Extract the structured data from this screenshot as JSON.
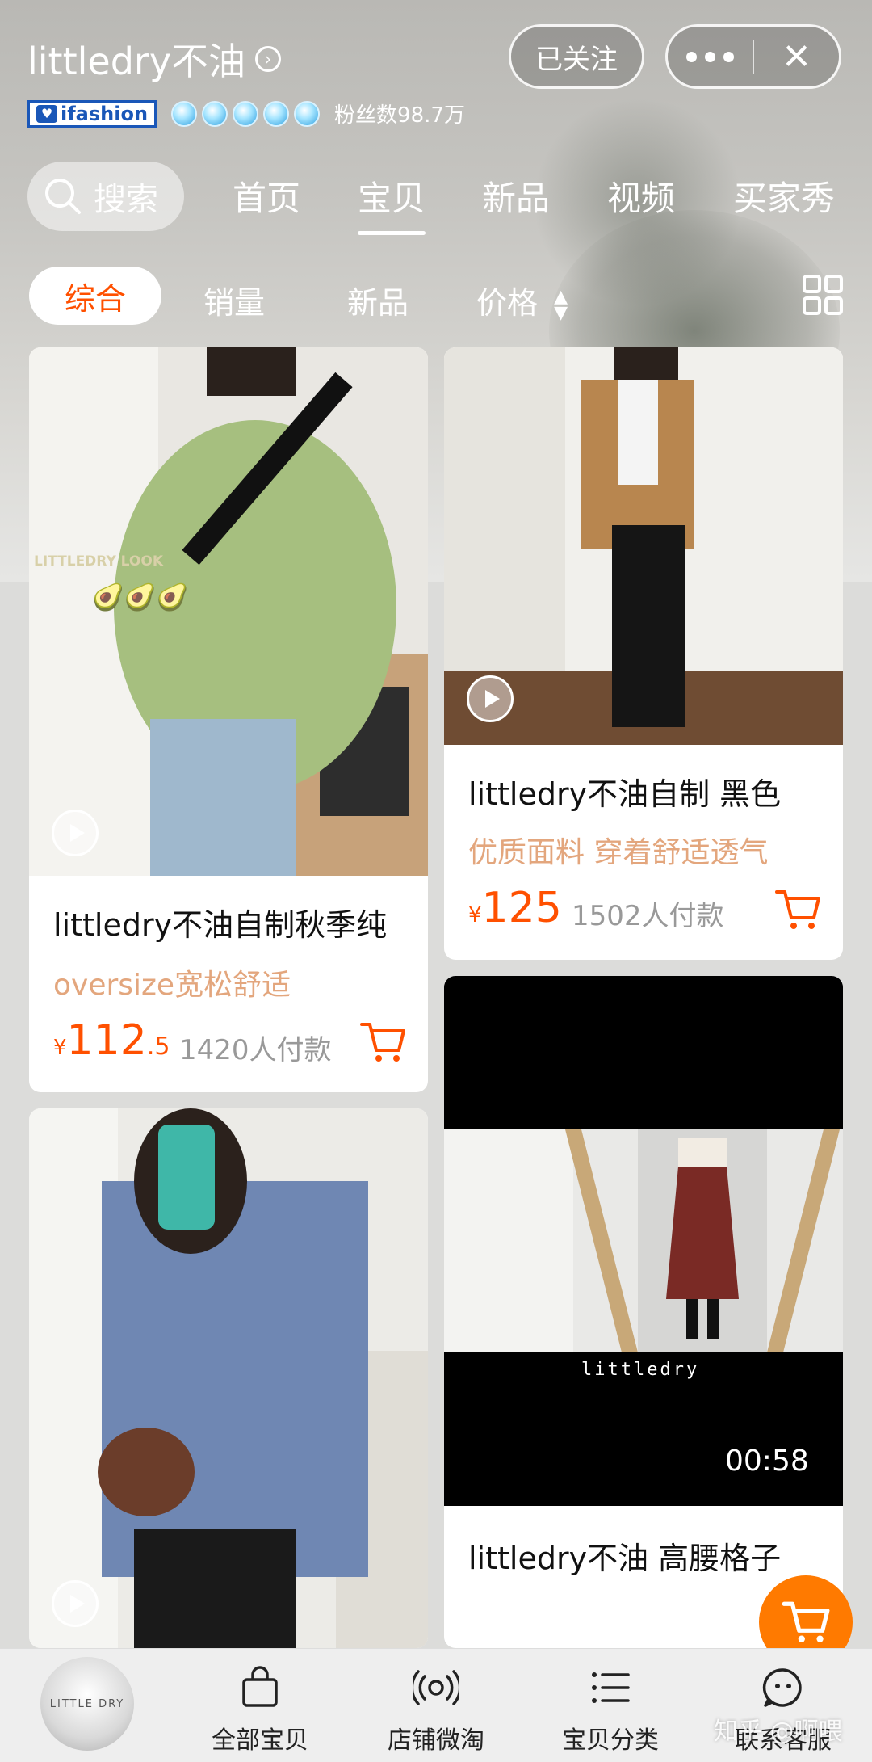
{
  "store": {
    "name": "littledry不油",
    "chevron": "›",
    "badge_text": "ifashion",
    "fans_label": "粉丝数98.7万",
    "follow_label": "已关注",
    "close_glyph": "✕"
  },
  "nav": {
    "search_label": "搜索",
    "tabs": [
      "首页",
      "宝贝",
      "新品",
      "视频",
      "买家秀"
    ],
    "active_tab": "宝贝"
  },
  "sort": {
    "items": [
      "综合",
      "销量",
      "新品",
      "价格"
    ],
    "arrows": [
      "▲",
      "▼"
    ]
  },
  "products": [
    {
      "title": "littledry不油自制秋季纯",
      "subtitle": "oversize宽松舒适",
      "price_symbol": "¥",
      "price_int": "112",
      "price_dec": ".5",
      "paid": "1420人付款",
      "overlay": "LITTLEDRY LOOK",
      "emoji": "🥑🥑🥑"
    },
    {
      "title": "littledry不油自制 黑色",
      "subtitle": "优质面料 穿着舒适透气",
      "price_symbol": "¥",
      "price_int": "125",
      "paid": "1502人付款"
    },
    {
      "title": "",
      "subtitle": "",
      "paid": ""
    },
    {
      "title": "littledry不油 高腰格子",
      "video_brand": "littledry",
      "duration": "00:58"
    }
  ],
  "bottom_bar": {
    "avatar_text": "LITTLE DRY",
    "items": [
      "全部宝贝",
      "店铺微淘",
      "宝贝分类",
      "联系客服"
    ]
  },
  "watermark": "知乎 @啊喂",
  "colors": {
    "accent": "#ff5000",
    "subtitle": "#e3a67d",
    "verified_blue": "#1a57b8"
  }
}
